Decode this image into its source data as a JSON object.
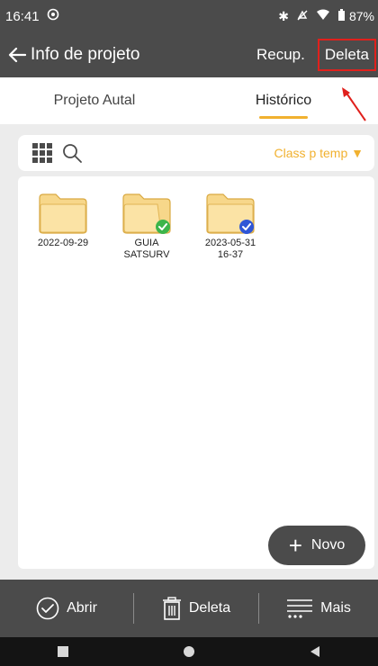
{
  "status_bar": {
    "time": "16:41",
    "battery": "87%"
  },
  "app_bar": {
    "title": "Info de projeto",
    "recup_label": "Recup.",
    "delete_label": "Deleta"
  },
  "tabs": [
    {
      "label": "Projeto Autal",
      "active": false
    },
    {
      "label": "Histórico",
      "active": true
    }
  ],
  "toolbar": {
    "sort_label": "Class p temp ▼"
  },
  "folders": [
    {
      "label": "2022-09-29",
      "badge": "none"
    },
    {
      "label": "GUIA\nSATSURV",
      "badge": "green-check"
    },
    {
      "label": "2023-05-31\n16-37",
      "badge": "blue-check"
    }
  ],
  "fab": {
    "label": "Novo"
  },
  "bottom_bar": {
    "open_label": "Abrir",
    "delete_label": "Deleta",
    "more_label": "Mais"
  },
  "colors": {
    "bar": "#4b4b4b",
    "accent": "#f1b12f",
    "highlight": "#e0201c",
    "green": "#3cb54a",
    "blue": "#2f56d6"
  }
}
